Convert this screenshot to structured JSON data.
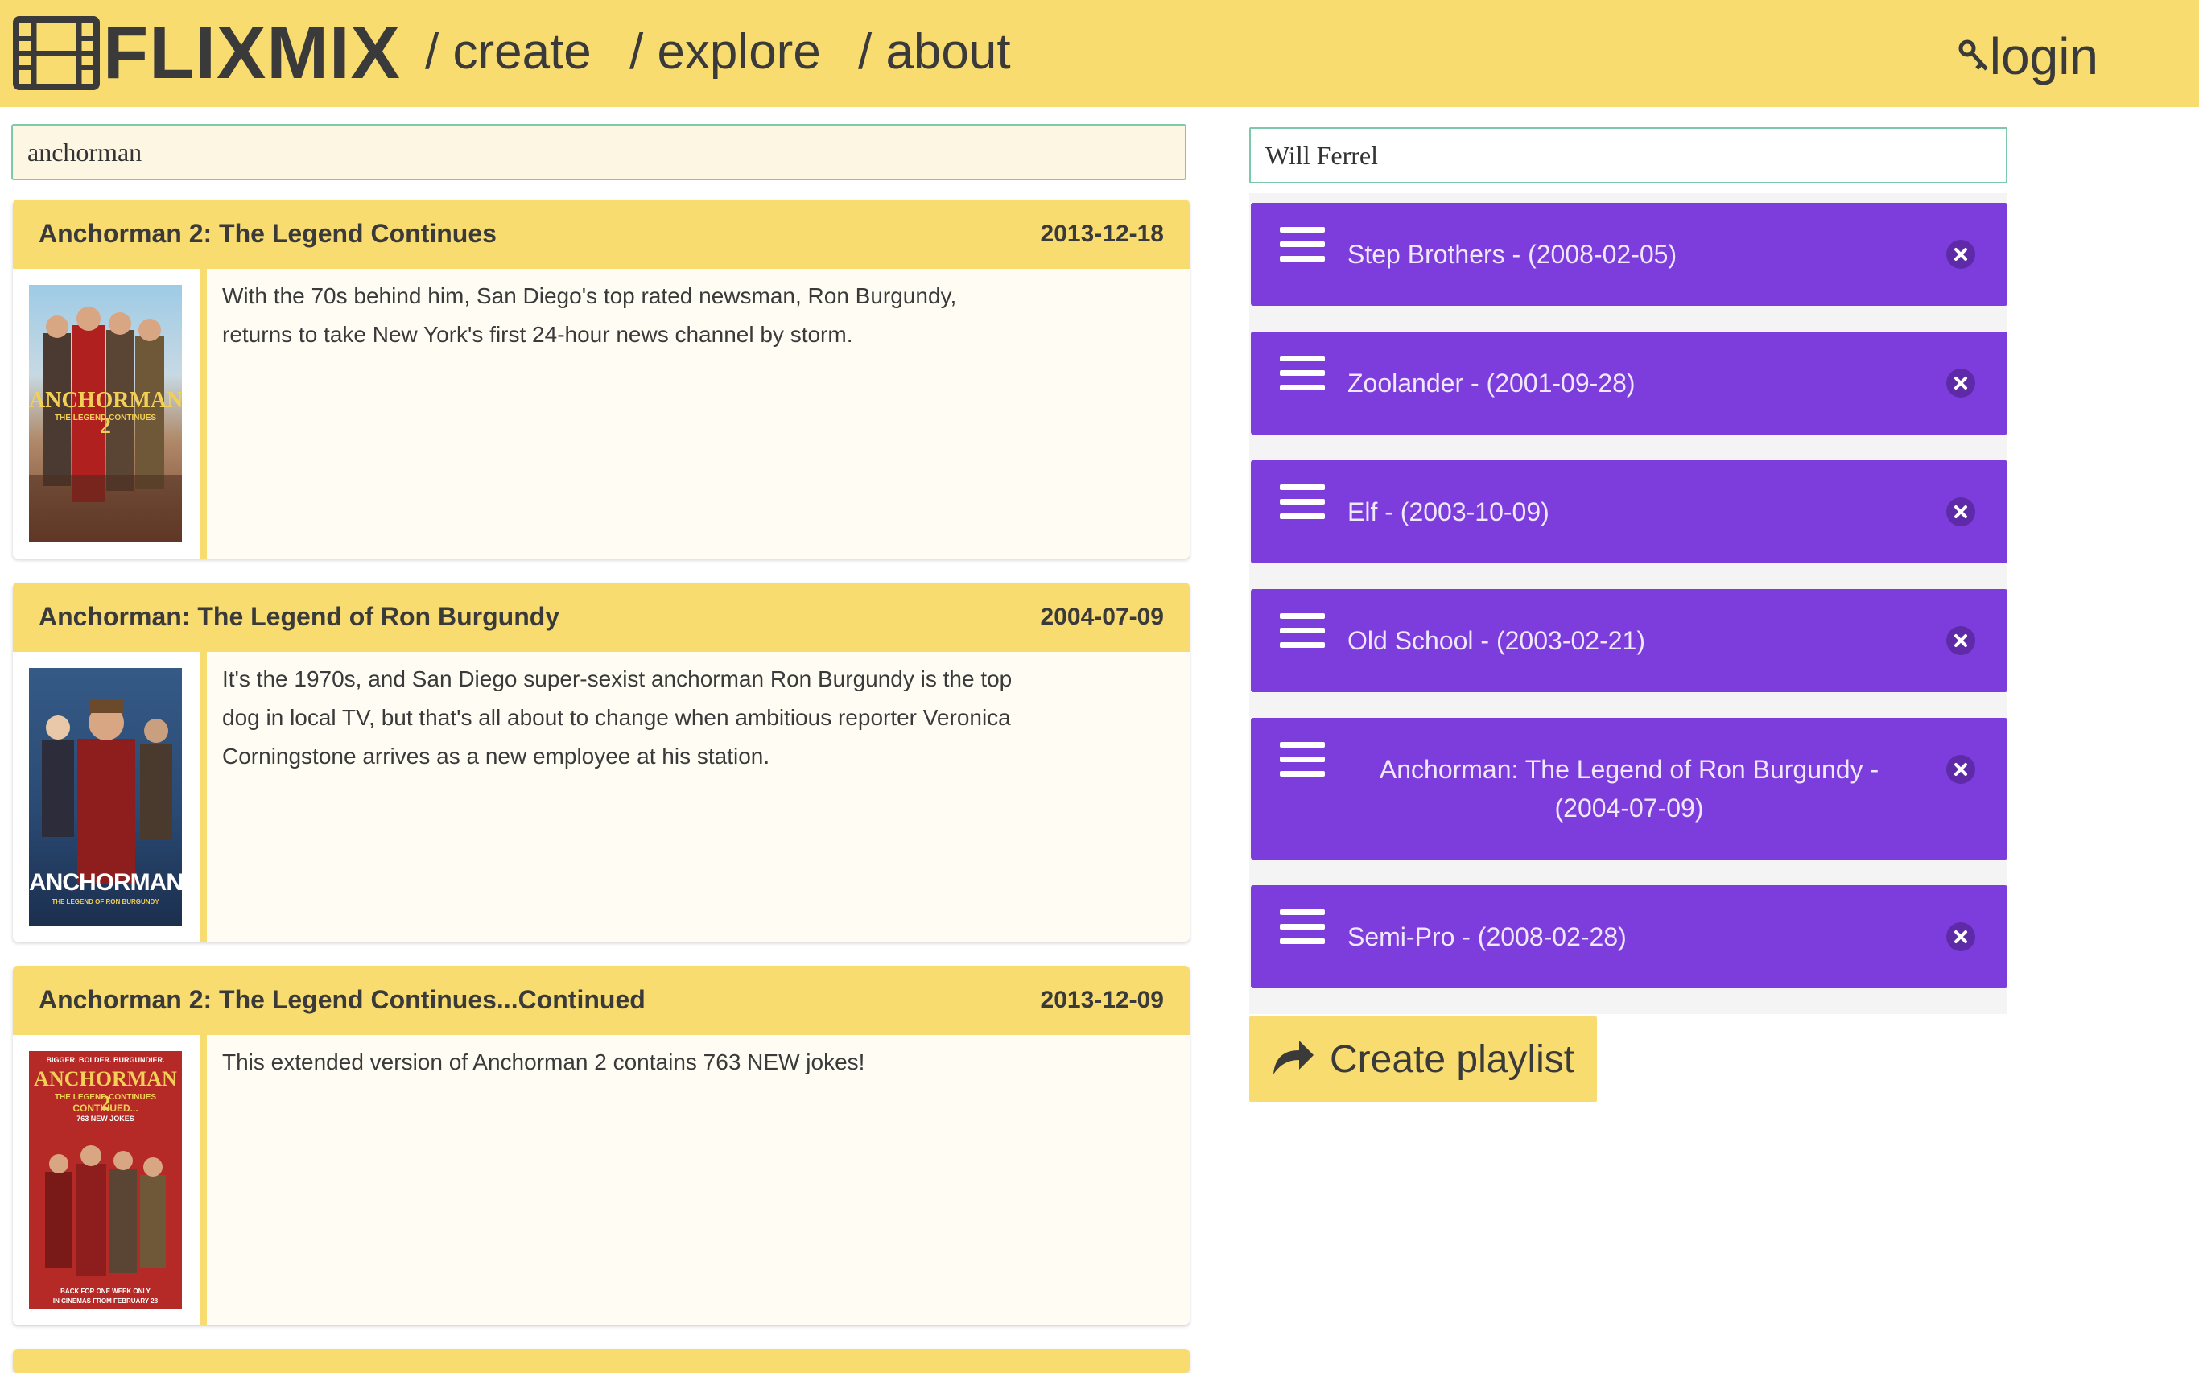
{
  "brand": {
    "name": "FLIXMIX",
    "logo_icon": "film-strip-icon"
  },
  "nav": [
    {
      "label": "/ create"
    },
    {
      "label": "/ explore"
    },
    {
      "label": "/ about"
    }
  ],
  "login": {
    "label": "login",
    "icon": "key-icon"
  },
  "search": {
    "value": "anchorman"
  },
  "actor_search": {
    "value": "Will Ferrel"
  },
  "results": [
    {
      "title": "Anchorman 2: The Legend Continues",
      "date": "2013-12-18",
      "description": "With the 70s behind him, San Diego's top rated newsman, Ron Burgundy, returns to take New York's first 24-hour news channel by storm.",
      "poster_title": "ANCHORMAN 2",
      "poster_subtitle": "THE LEGEND CONTINUES"
    },
    {
      "title": "Anchorman: The Legend of Ron Burgundy",
      "date": "2004-07-09",
      "description": "It's the 1970s, and San Diego super-sexist anchorman Ron Burgundy is the top dog in local TV, but that's all about to change when ambitious reporter Veronica Corningstone arrives as a new employee at his station.",
      "poster_title": "ANCHORMAN",
      "poster_subtitle": "THE LEGEND OF RON BURGUNDY"
    },
    {
      "title": "Anchorman 2: The Legend Continues...Continued",
      "date": "2013-12-09",
      "description": "This extended version of Anchorman 2 contains 763 NEW jokes!",
      "poster_top": "BIGGER. BOLDER. BURGUNDIER.",
      "poster_title": "ANCHORMAN 2",
      "poster_subtitle": "THE LEGEND CONTINUES",
      "poster_sub2": "CONTINUED...",
      "poster_sub3": "763 NEW JOKES",
      "poster_bottom1": "BACK FOR ONE WEEK ONLY",
      "poster_bottom2": "IN CINEMAS FROM FEBRUARY 28"
    }
  ],
  "playlist": {
    "items": [
      {
        "label": "Step Brothers - (2008-02-05)"
      },
      {
        "label": "Zoolander - (2001-09-28)"
      },
      {
        "label": "Elf - (2003-10-09)"
      },
      {
        "label": "Old School - (2003-02-21)"
      },
      {
        "label": "Anchorman: The Legend of Ron Burgundy - (2004-07-09)"
      },
      {
        "label": "Semi-Pro - (2008-02-28)"
      }
    ],
    "create_label": "Create playlist",
    "create_icon": "share-arrow-icon"
  },
  "colors": {
    "header": "#f8dc70",
    "playlist_item": "#7c3ddc",
    "input_border": "#7cc9ac"
  }
}
